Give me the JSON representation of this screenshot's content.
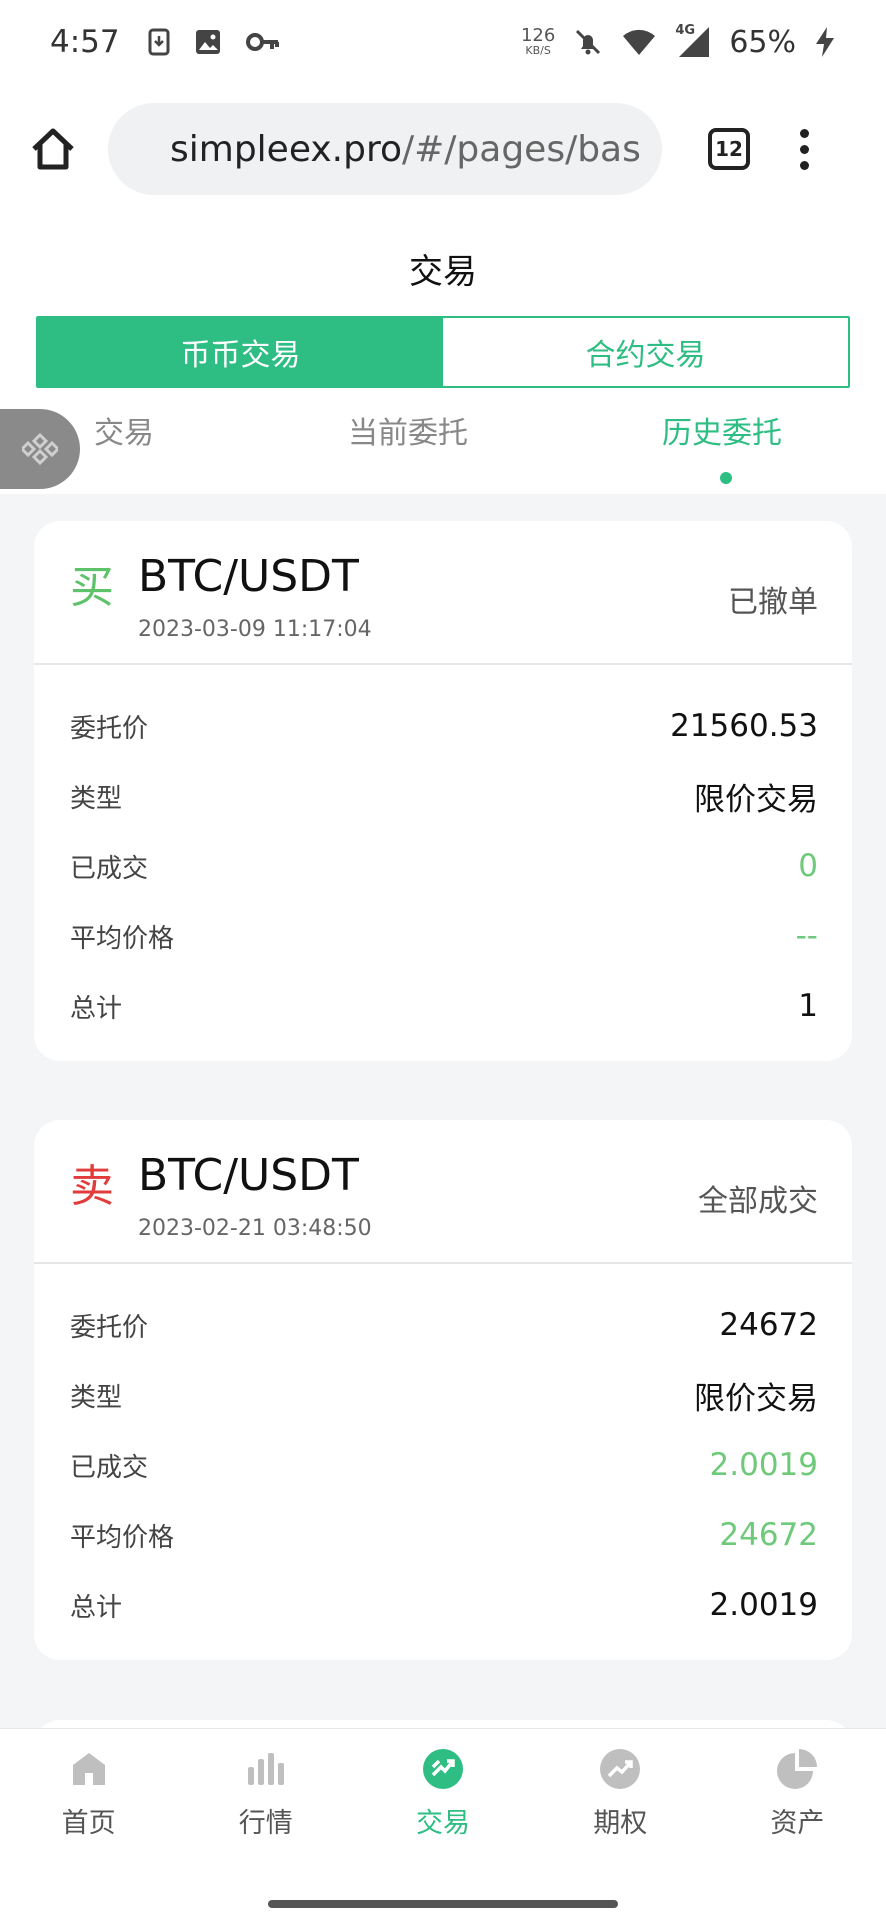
{
  "status_bar": {
    "time": "4:57",
    "net_speed_value": "126",
    "net_speed_unit": "KB/S",
    "network_type": "4G",
    "battery": "65%"
  },
  "browser": {
    "url_main": "simpleex.pro",
    "url_path": "/#/pages/bas",
    "tab_count": "12"
  },
  "page": {
    "title": "交易",
    "segments": [
      "币币交易",
      "合约交易"
    ],
    "subtabs": [
      "交易",
      "当前委托",
      "历史委托"
    ]
  },
  "orders": [
    {
      "side": "买",
      "pair": "BTC/USDT",
      "time": "2023-03-09 11:17:04",
      "status": "已撤单",
      "rows": [
        {
          "label": "委托价",
          "value": "21560.53"
        },
        {
          "label": "类型",
          "value": "限价交易"
        },
        {
          "label": "已成交",
          "value": "0"
        },
        {
          "label": "平均价格",
          "value": "--"
        },
        {
          "label": "总计",
          "value": "1"
        }
      ]
    },
    {
      "side": "卖",
      "pair": "BTC/USDT",
      "time": "2023-02-21 03:48:50",
      "status": "全部成交",
      "rows": [
        {
          "label": "委托价",
          "value": "24672"
        },
        {
          "label": "类型",
          "value": "限价交易"
        },
        {
          "label": "已成交",
          "value": "2.0019"
        },
        {
          "label": "平均价格",
          "value": "24672"
        },
        {
          "label": "总计",
          "value": "2.0019"
        }
      ]
    }
  ],
  "bottom_nav": [
    "首页",
    "行情",
    "交易",
    "期权",
    "资产"
  ],
  "colors": {
    "accent": "#2ebd83",
    "buy": "#5ec26a",
    "sell": "#e23b3b"
  }
}
